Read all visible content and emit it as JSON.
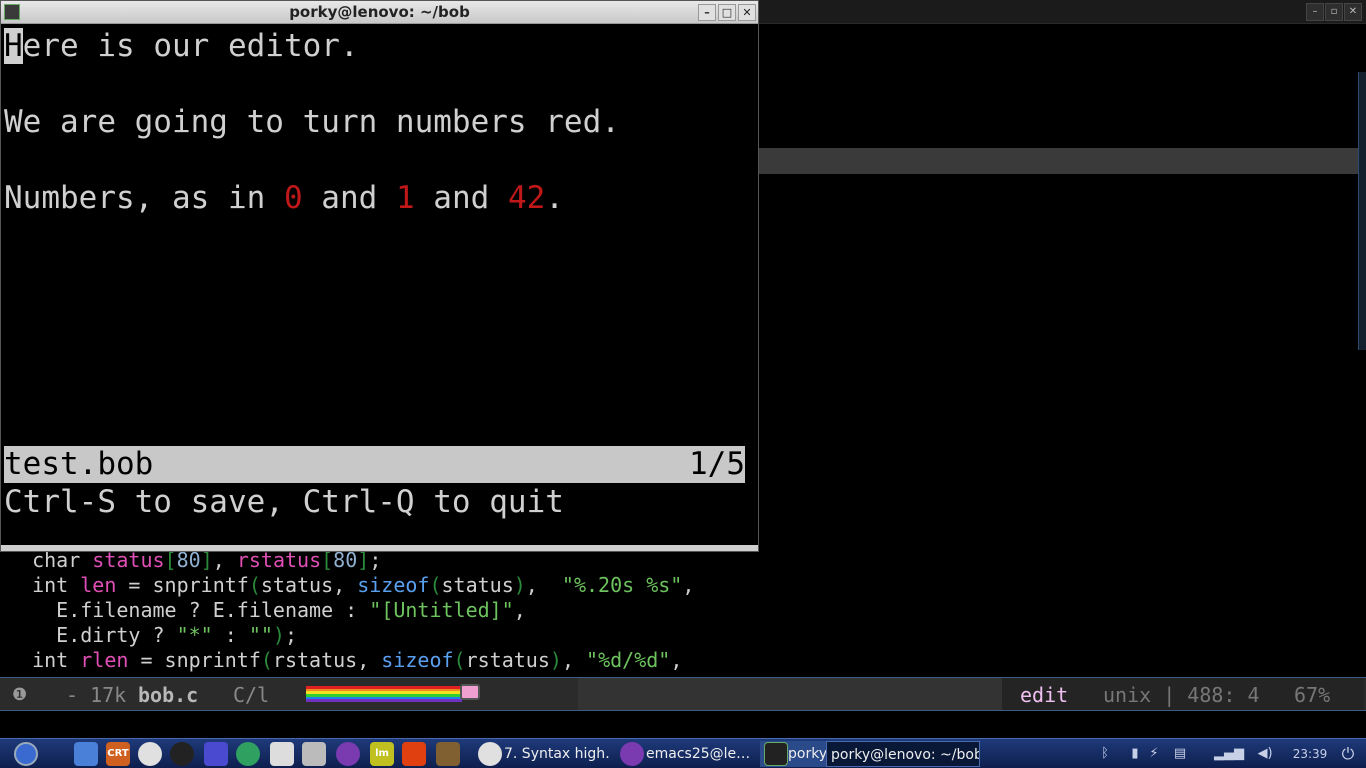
{
  "terminal": {
    "title": "porky@lenovo: ~/bob",
    "buttons": {
      "minimize": "–",
      "maximize": "□",
      "close": "✕"
    },
    "lines": [
      {
        "cursor_char": "H",
        "rest": "ere is our editor."
      },
      {
        "text": "We are going to turn numbers red."
      },
      {
        "parts": [
          "Numbers, as in ",
          "0",
          " and ",
          "1",
          " and ",
          "42",
          "."
        ]
      }
    ],
    "status_left": "test.bob",
    "status_right": "1/5",
    "message": "Ctrl-S to save, Ctrl-Q to quit"
  },
  "emacs": {
    "title_buttons": {
      "minimize": "–",
      "restore": "▫",
      "close": "✕"
    },
    "code_lines": [
      [
        [
          "kw",
          "  char "
        ],
        [
          "vr",
          "status"
        ],
        [
          "pu",
          "["
        ],
        [
          "nm",
          "80"
        ],
        [
          "pu",
          "]"
        ],
        [
          "kw",
          ", "
        ],
        [
          "vr",
          "rstatus"
        ],
        [
          "pu",
          "["
        ],
        [
          "nm",
          "80"
        ],
        [
          "pu",
          "]"
        ],
        [
          "kw",
          ";"
        ]
      ],
      [
        [
          "kw",
          "  int "
        ],
        [
          "vr",
          "len"
        ],
        [
          "kw",
          " = snprintf"
        ],
        [
          "pu",
          "("
        ],
        [
          "kw",
          "status, "
        ],
        [
          "fn",
          "sizeof"
        ],
        [
          "pu",
          "("
        ],
        [
          "kw",
          "status"
        ],
        [
          "pu",
          ")"
        ],
        [
          "kw",
          ",  "
        ],
        [
          "st",
          "\"%.20s %s\""
        ],
        [
          "kw",
          ","
        ]
      ],
      [
        [
          "kw",
          "    E.filename ? E.filename : "
        ],
        [
          "st",
          "\"[Untitled]\""
        ],
        [
          "kw",
          ","
        ]
      ],
      [
        [
          "kw",
          "    E.dirty ? "
        ],
        [
          "st",
          "\"*\""
        ],
        [
          "kw",
          " : "
        ],
        [
          "st",
          "\"\""
        ],
        [
          "pu",
          ")"
        ],
        [
          "kw",
          ";"
        ]
      ],
      [
        [
          "kw",
          "  int "
        ],
        [
          "vr",
          "rlen"
        ],
        [
          "kw",
          " = snprintf"
        ],
        [
          "pu",
          "("
        ],
        [
          "kw",
          "rstatus, "
        ],
        [
          "fn",
          "sizeof"
        ],
        [
          "pu",
          "("
        ],
        [
          "kw",
          "rstatus"
        ],
        [
          "pu",
          ")"
        ],
        [
          "kw",
          ", "
        ],
        [
          "st",
          "\"%d/%d\""
        ],
        [
          "kw",
          ","
        ]
      ]
    ],
    "modeline": {
      "indicator": "❶",
      "size": "- 17k",
      "buffer": "bob.c",
      "mode": "C/l",
      "evil_state": "edit",
      "encoding": "unix | 488: 4",
      "percent": "67%"
    }
  },
  "taskbar": {
    "launchers": [
      {
        "icon": "menu-icon",
        "label": ""
      },
      {
        "icon": "file-manager-icon",
        "label": ""
      },
      {
        "icon": "crt-icon",
        "label": "CRT"
      },
      {
        "icon": "chrome-icon",
        "label": ""
      },
      {
        "icon": "obs-icon",
        "label": ""
      },
      {
        "icon": "app-arrow-icon",
        "label": ""
      },
      {
        "icon": "atom-icon",
        "label": ""
      },
      {
        "icon": "text-editor-icon",
        "label": ""
      },
      {
        "icon": "notes-icon",
        "label": ""
      },
      {
        "icon": "emacs-icon",
        "label": ""
      },
      {
        "icon": "lm-icon",
        "label": "lm"
      },
      {
        "icon": "flame-icon",
        "label": ""
      },
      {
        "icon": "gimp-icon",
        "label": ""
      }
    ],
    "tasks": [
      {
        "label": "7. Syntax high…"
      },
      {
        "label": "emacs25@le…"
      },
      {
        "label": "porky"
      },
      {
        "label": "porky@lenovo: ~/bob"
      }
    ],
    "clock": "23:39"
  },
  "colors": {
    "number_red": "#c01818",
    "keyword_pink": "#e04fb5",
    "func_blue": "#5aa0f0",
    "string_green": "#6dc35e",
    "status_bar": "#c8c8c8",
    "taskbar_blue": "#1e3a7a"
  }
}
